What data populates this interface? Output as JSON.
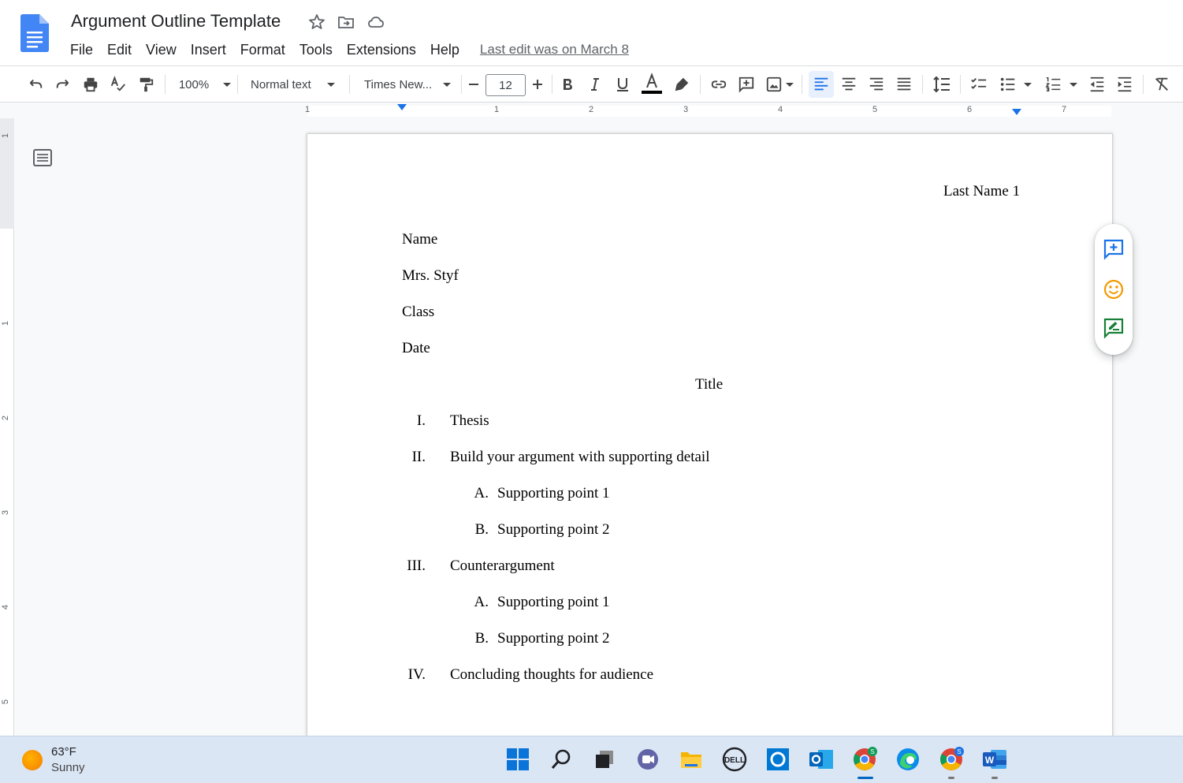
{
  "document": {
    "title": "Argument Outline Template",
    "last_edit": "Last edit was on March 8"
  },
  "menu": [
    "File",
    "Edit",
    "View",
    "Insert",
    "Format",
    "Tools",
    "Extensions",
    "Help"
  ],
  "toolbar": {
    "zoom": "100%",
    "style": "Normal text",
    "font": "Times New...",
    "font_size": "12"
  },
  "ruler": {
    "h_numbers": [
      "1",
      "1",
      "2",
      "3",
      "4",
      "5",
      "6",
      "7"
    ],
    "v_numbers": [
      "1",
      "1",
      "2",
      "3",
      "4",
      "5"
    ]
  },
  "page": {
    "header_right": "Last Name 1",
    "heading_lines": [
      "Name",
      "Mrs. Styf",
      "Class",
      "Date"
    ],
    "title": "Title",
    "outline": [
      {
        "marker": "I.",
        "text": "Thesis",
        "level": 1
      },
      {
        "marker": "II.",
        "text": "Build your argument with supporting detail",
        "level": 1
      },
      {
        "marker": "A.",
        "text": "Supporting point 1",
        "level": 2
      },
      {
        "marker": "B.",
        "text": "Supporting point 2",
        "level": 2
      },
      {
        "marker": "III.",
        "text": "Counterargument",
        "level": 1
      },
      {
        "marker": "A.",
        "text": "Supporting point 1",
        "level": 2
      },
      {
        "marker": "B.",
        "text": "Supporting point 2",
        "level": 2
      },
      {
        "marker": "IV.",
        "text": "Concluding thoughts for audience",
        "level": 1
      }
    ]
  },
  "taskbar": {
    "weather_temp": "63°F",
    "weather_desc": "Sunny",
    "apps": [
      "windows-start",
      "search",
      "task-view",
      "teams-chat",
      "file-explorer",
      "dell",
      "cortana",
      "outlook",
      "chrome",
      "edge",
      "chrome-profile",
      "word"
    ]
  },
  "colors": {
    "accent": "#1a73e8",
    "docs_blue": "#4285f4",
    "emoji_yellow": "#f29900",
    "suggest_green": "#188038"
  }
}
